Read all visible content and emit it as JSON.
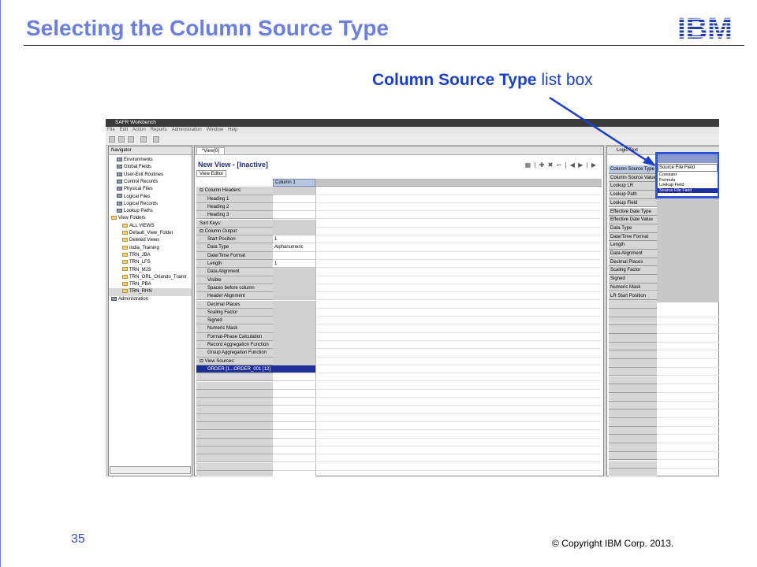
{
  "slide": {
    "title": "Selecting the Column Source Type",
    "callout_bold": "Column Source Type",
    "callout_rest": " list box",
    "page_number": "35",
    "copyright": "© Copyright  IBM Corp. 2013.",
    "logo": "IBM"
  },
  "window": {
    "title": "SAFR Workbench",
    "menu": [
      "File",
      "Edit",
      "Action",
      "Reports",
      "Administration",
      "Window",
      "Help"
    ]
  },
  "navigator": {
    "tab_label": "Navigator",
    "items": [
      {
        "label": "Environments",
        "icon": "generic-icon",
        "indent": 1
      },
      {
        "label": "Global Fields",
        "icon": "generic-icon",
        "indent": 1
      },
      {
        "label": "User-Exit Routines",
        "icon": "generic-icon",
        "indent": 1
      },
      {
        "label": "Control Records",
        "icon": "generic-icon",
        "indent": 1
      },
      {
        "label": "Physical Files",
        "icon": "generic-icon",
        "indent": 1
      },
      {
        "label": "Logical Files",
        "icon": "generic-icon",
        "indent": 1
      },
      {
        "label": "Logical Records",
        "icon": "generic-icon",
        "indent": 1
      },
      {
        "label": "Lookup Paths",
        "icon": "generic-icon",
        "indent": 1
      },
      {
        "label": "View Folders",
        "icon": "folder-icon",
        "indent": 0
      },
      {
        "label": "ALL VIEWS",
        "icon": "folder-icon",
        "indent": 2
      },
      {
        "label": "Default_View_Folder",
        "icon": "folder-icon",
        "indent": 2
      },
      {
        "label": "Deleted Views",
        "icon": "folder-icon",
        "indent": 2
      },
      {
        "label": "India_Training",
        "icon": "folder-icon",
        "indent": 2
      },
      {
        "label": "TRN_JBA",
        "icon": "folder-icon",
        "indent": 2
      },
      {
        "label": "TRN_LFS",
        "icon": "folder-icon",
        "indent": 2
      },
      {
        "label": "TRN_MJS",
        "icon": "folder-icon",
        "indent": 2
      },
      {
        "label": "TRN_ORL_Orlando_Trainir",
        "icon": "folder-icon",
        "indent": 2
      },
      {
        "label": "TRN_PBA",
        "icon": "folder-icon",
        "indent": 2
      },
      {
        "label": "TRN_RHN",
        "icon": "folder-icon",
        "indent": 2
      },
      {
        "label": "Administration",
        "icon": "generic-icon",
        "indent": 0
      }
    ]
  },
  "editor": {
    "tab_label": "*View[0]",
    "title": "New View - [Inactive]",
    "subtab": "View Editor",
    "column_header": "Column 1",
    "rows": [
      {
        "label": "⊟  Column Headers:",
        "value": "",
        "header": true
      },
      {
        "label": "Heading 1",
        "value": ""
      },
      {
        "label": "Heading 2",
        "value": ""
      },
      {
        "label": "Heading 3",
        "value": ""
      },
      {
        "label": "Sort Keys:",
        "value": "",
        "header": true
      },
      {
        "label": "⊟  Column Output:",
        "value": "",
        "header": true
      },
      {
        "label": "Start Position",
        "value": "1"
      },
      {
        "label": "Data Type",
        "value": "Alphanumeric"
      },
      {
        "label": "Date/Time Format",
        "value": ""
      },
      {
        "label": "Length",
        "value": "1"
      },
      {
        "label": "Data Alignment",
        "value": ""
      },
      {
        "label": "Visible",
        "value": ""
      },
      {
        "label": "Spaces before column",
        "value": ""
      },
      {
        "label": "Header Alignment",
        "value": ""
      },
      {
        "label": "Decimal Places",
        "value": ""
      },
      {
        "label": "Scaling Factor",
        "value": ""
      },
      {
        "label": "Signed",
        "value": ""
      },
      {
        "label": "Numeric Mask",
        "value": ""
      },
      {
        "label": "Format-Phase Calculation",
        "value": ""
      },
      {
        "label": "Record Aggregation Function",
        "value": ""
      },
      {
        "label": "Group Aggregation Function",
        "value": ""
      },
      {
        "label": "⊟  View Sources:",
        "value": "",
        "header": true
      },
      {
        "label": "ORDER [1...ORDER_001 [12]",
        "value": "",
        "selected": true
      }
    ]
  },
  "logic_panel": {
    "tab_label": "Logic Text",
    "properties": [
      "Column Source Type",
      "Column Source Value",
      "Lookup LR",
      "Lookup Path",
      "Lookup Field",
      "Effective Date Type",
      "Effective Date Value",
      "Data Type",
      "Date/Time Format",
      "Length",
      "Data Alignment",
      "Decimal Places",
      "Scaling Factor",
      "Signed",
      "Numeric Mask",
      "LR Start Position"
    ]
  },
  "dropdown": {
    "current": "Source File Field",
    "options": [
      "Constant",
      "Formula",
      "Lookup Field",
      "Source File Field"
    ],
    "selected_index": 3
  },
  "colors": {
    "title": "#6b7fe0",
    "callout": "#1a3fcf",
    "highlight": "#2b55d6"
  }
}
